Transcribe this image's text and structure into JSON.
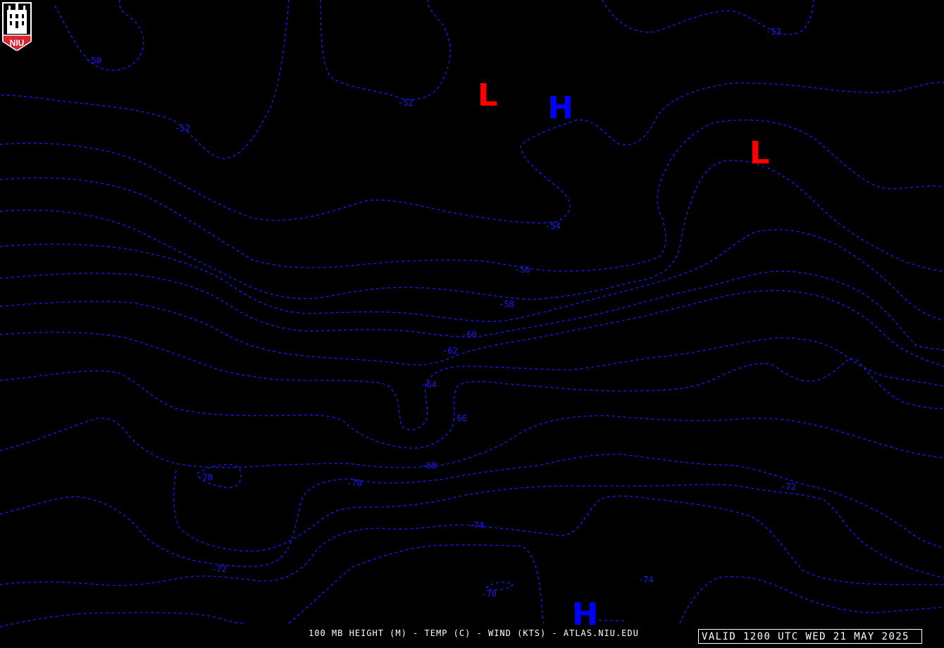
{
  "logo": {
    "text": "NIU",
    "icon": "niu-building-logo",
    "color": "#d9232e"
  },
  "colors": {
    "contour": "#1a1aff",
    "low": "#ff0000",
    "high": "#0000ff",
    "text": "#ffffff",
    "background": "#000000"
  },
  "caption": "100 MB HEIGHT (M) - TEMP (C) - WIND (KTS) - ATLAS.NIU.EDU",
  "valid_time": "VALID 1200 UTC WED 21 MAY 2025",
  "pressure_centers": [
    {
      "type": "L",
      "label": "L"
    },
    {
      "type": "H",
      "label": "H"
    },
    {
      "type": "L",
      "label": "L"
    },
    {
      "type": "H",
      "label": "H"
    }
  ],
  "contour_labels": [
    "-50",
    "-52",
    "-52",
    "-52",
    "-54",
    "-56",
    "-58",
    "-60",
    "-62",
    "-64",
    "-66",
    "-68",
    "-70",
    "-70",
    "-72",
    "-72",
    "-74",
    "-74",
    "-70"
  ]
}
